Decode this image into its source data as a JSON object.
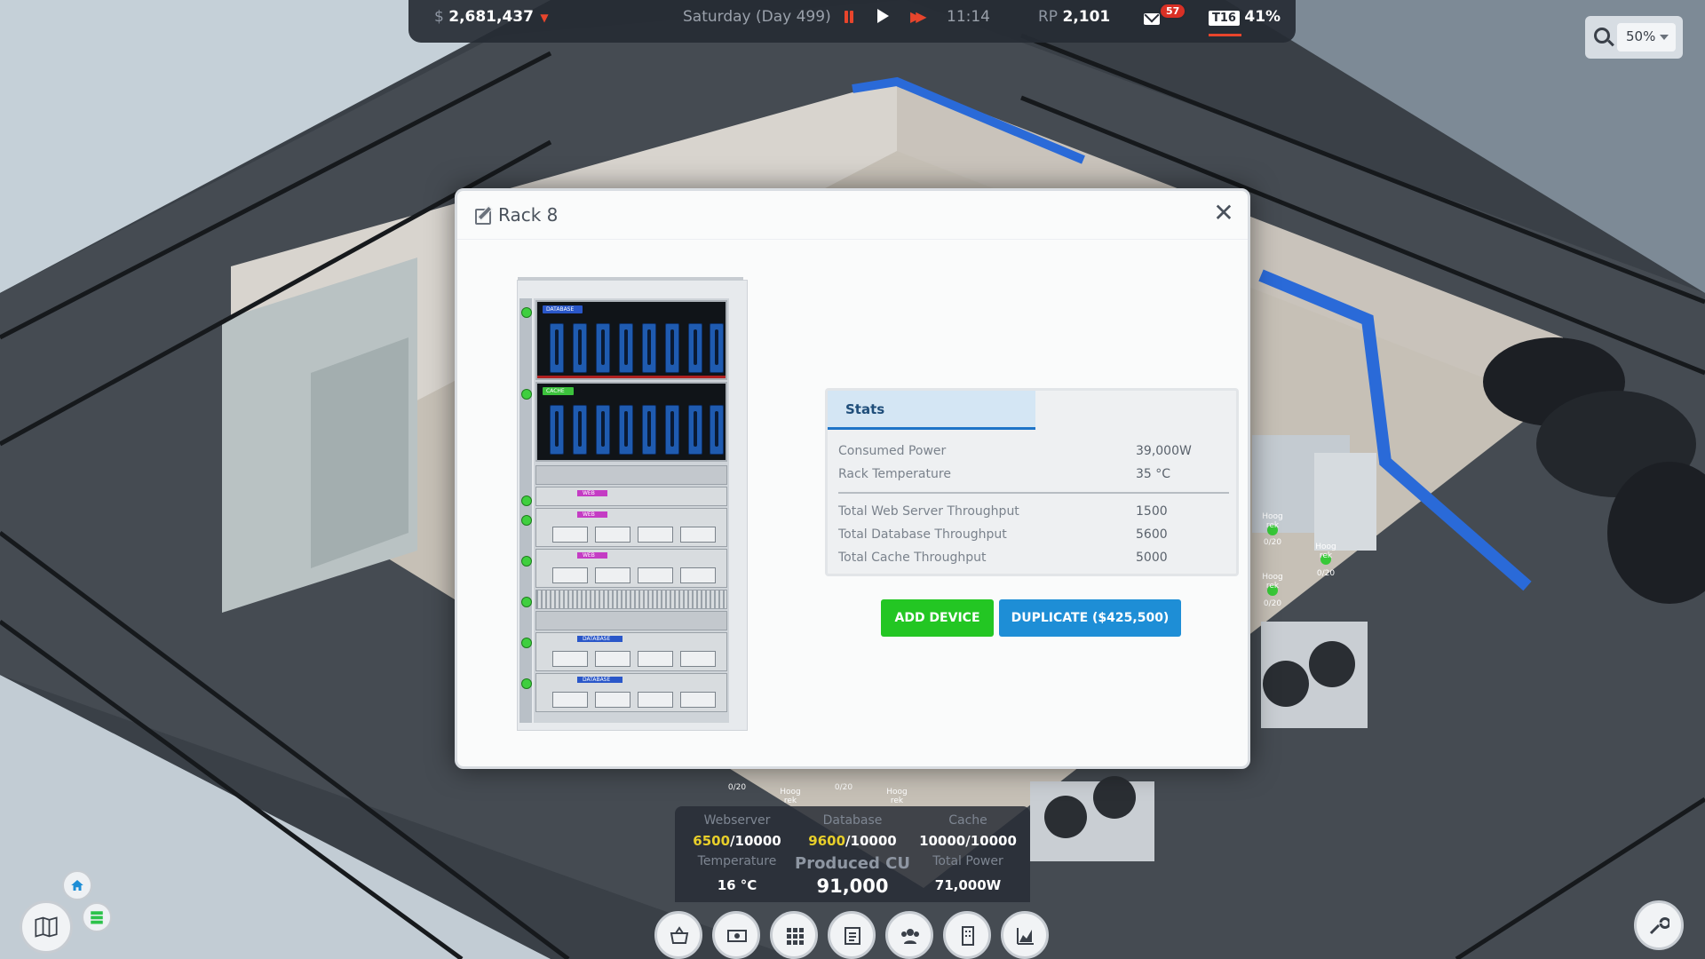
{
  "topbar": {
    "money_symbol": "$",
    "money": "2,681,437",
    "day": "Saturday (Day 499)",
    "time": "11:14",
    "rp_label": "RP",
    "rp_value": "2,101",
    "mail_count": "57",
    "tier": "T16",
    "tier_percent": "41%"
  },
  "zoom": {
    "value": "50%"
  },
  "modal": {
    "title": "Rack 8",
    "close_label": "✕",
    "rack": {
      "banks": [
        {
          "label": "DATABASE",
          "color": "#2a57c9"
        },
        {
          "label": "CACHE",
          "color": "#3cc23c"
        }
      ],
      "units": [
        {
          "label": "WEB",
          "color": "#c43cc4"
        },
        {
          "label": "WEB",
          "color": "#c43cc4"
        },
        {
          "label": "WEB",
          "color": "#c43cc4"
        },
        {
          "label": "DATABASE",
          "color": "#2a57c9"
        },
        {
          "label": "DATABASE",
          "color": "#2a57c9"
        }
      ]
    },
    "stats": {
      "tab": "Stats",
      "rows": [
        {
          "label": "Consumed Power",
          "value": "39,000W"
        },
        {
          "label": "Rack Temperature",
          "value": "35 °C"
        },
        {
          "label": "Total Web Server Throughput",
          "value": "1500"
        },
        {
          "label": "Total Database Throughput",
          "value": "5600"
        },
        {
          "label": "Total Cache Throughput",
          "value": "5000"
        }
      ]
    },
    "add_device": "ADD DEVICE",
    "duplicate": "DUPLICATE ($425,500)"
  },
  "info": {
    "webserver_label": "Webserver",
    "webserver_used": "6500",
    "webserver_total": "/10000",
    "database_label": "Database",
    "database_used": "9600",
    "database_total": "/10000",
    "cache_label": "Cache",
    "cache_value": "10000/10000",
    "temperature_label": "Temperature",
    "temperature_value": "16 °C",
    "produced_label": "Produced CU",
    "produced_value": "91,000",
    "power_label": "Total Power",
    "power_value": "71,000W"
  },
  "world_labels": {
    "rack_name": "Hoog rek",
    "capacity": "0/20"
  },
  "toolbar": [
    "basket-icon",
    "money-icon",
    "grid-icon",
    "list-icon",
    "people-icon",
    "building-icon",
    "chart-icon"
  ],
  "colors": {
    "accent_red": "#e8452c",
    "green_button": "#23c623",
    "blue_button": "#1e8ed6",
    "tab_underline": "#1e74c8"
  }
}
